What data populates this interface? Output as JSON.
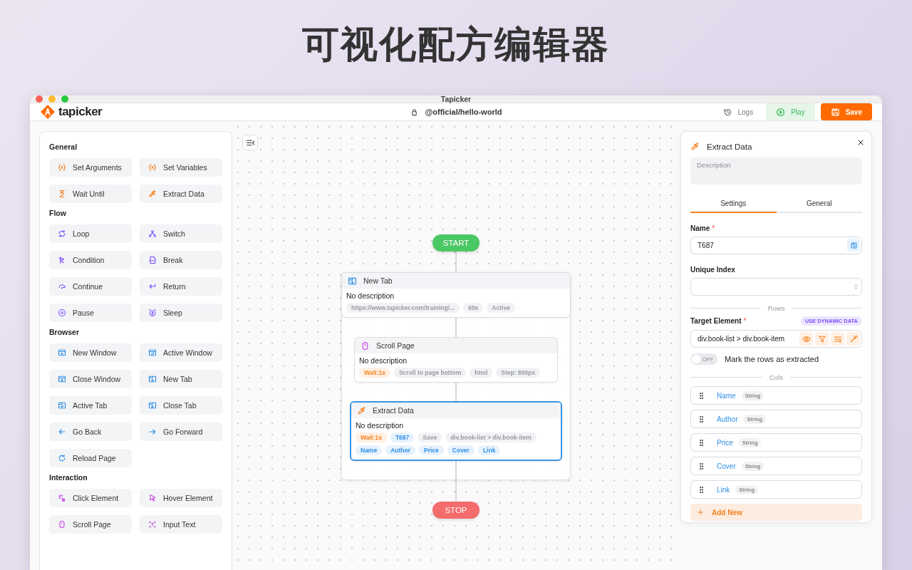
{
  "headline": "可视化配方编辑器",
  "window": {
    "title": "Tapicker"
  },
  "toolbar": {
    "logo": "tapicker",
    "project": "@official/hello-world",
    "logs": "Logs",
    "play": "Play",
    "save": "Save"
  },
  "palette": [
    {
      "title": "General",
      "kind": "general",
      "items": [
        {
          "label": "Set Arguments",
          "kind": "args"
        },
        {
          "label": "Set Variables",
          "kind": "vars"
        },
        {
          "label": "Wait Until",
          "kind": "hourglass"
        },
        {
          "label": "Extract Data",
          "kind": "dropper"
        }
      ]
    },
    {
      "title": "Flow",
      "kind": "flow",
      "items": [
        {
          "label": "Loop",
          "kind": "loop"
        },
        {
          "label": "Switch",
          "kind": "switch"
        },
        {
          "label": "Condition",
          "kind": "condition"
        },
        {
          "label": "Break",
          "kind": "break"
        },
        {
          "label": "Continue",
          "kind": "continue"
        },
        {
          "label": "Return",
          "kind": "return"
        },
        {
          "label": "Pause",
          "kind": "pause"
        },
        {
          "label": "Sleep",
          "kind": "sleep"
        }
      ]
    },
    {
      "title": "Browser",
      "kind": "browser",
      "items": [
        {
          "label": "New Window",
          "kind": "win-plus"
        },
        {
          "label": "Active Window",
          "kind": "win-check"
        },
        {
          "label": "Close Window",
          "kind": "win-x"
        },
        {
          "label": "New Tab",
          "kind": "tab-plus"
        },
        {
          "label": "Active Tab",
          "kind": "tab-check"
        },
        {
          "label": "Close Tab",
          "kind": "tab-x"
        },
        {
          "label": "Go Back",
          "kind": "back"
        },
        {
          "label": "Go Forward",
          "kind": "forward"
        },
        {
          "label": "Reload Page",
          "kind": "reload"
        }
      ]
    },
    {
      "title": "Interaction",
      "kind": "interaction",
      "items": [
        {
          "label": "Click Element",
          "kind": "click"
        },
        {
          "label": "Hover Element",
          "kind": "pointer"
        },
        {
          "label": "Scroll Page",
          "kind": "mouse"
        },
        {
          "label": "Input Text",
          "kind": "text"
        }
      ]
    }
  ],
  "flow": {
    "start": "START",
    "stop": "STOP",
    "nodes": [
      {
        "title": "New Tab",
        "kind": "tab-plus",
        "selected": false,
        "description": "No description",
        "tags": [
          {
            "text": "https://www.tapicker.com/training/...",
            "kind": "plain"
          },
          {
            "text": "60s",
            "kind": "plain"
          },
          {
            "text": "Active",
            "kind": "plain"
          }
        ]
      },
      {
        "title": "Scroll Page",
        "kind": "mouse",
        "selected": false,
        "description": "No description",
        "tags": [
          {
            "text": "Wait:1s",
            "kind": "wait"
          },
          {
            "text": "Scroll to page bottom",
            "kind": "plain"
          },
          {
            "text": "html",
            "kind": "plain"
          },
          {
            "text": "Step: 800px",
            "kind": "plain"
          }
        ]
      },
      {
        "title": "Extract Data",
        "kind": "dropper",
        "selected": true,
        "description": "No description",
        "tags": [
          {
            "text": "Wait:1s",
            "kind": "wait"
          },
          {
            "text": "T687",
            "kind": "field"
          },
          {
            "text": "Save",
            "kind": "plain"
          },
          {
            "text": "div.book-list > div.book-item",
            "kind": "plain"
          },
          {
            "text": "Name",
            "kind": "field"
          },
          {
            "text": "Author",
            "kind": "field"
          },
          {
            "text": "Price",
            "kind": "field"
          },
          {
            "text": "Cover",
            "kind": "field"
          },
          {
            "text": "Link",
            "kind": "field"
          }
        ]
      }
    ]
  },
  "props": {
    "title": "Extract Data",
    "description_placeholder": "Description",
    "tabs": [
      {
        "label": "Settings",
        "selected": true
      },
      {
        "label": "General",
        "selected": false
      }
    ],
    "name_label": "Name",
    "name_required_mark": "*",
    "name_value": "T687",
    "unique_label": "Unique Index",
    "rows_divider": "Rows",
    "target_label": "Target Element",
    "target_required_mark": "*",
    "dynamic_badge": "USE DYNAMIC DATA",
    "target_value": "div.book-list > div.book-item",
    "mark_toggle": {
      "on": false,
      "text": "OFF",
      "label": "Mark the rows as extracted"
    },
    "cols_divider": "Cols",
    "cols": [
      {
        "name": "Name",
        "type": "String"
      },
      {
        "name": "Author",
        "type": "String"
      },
      {
        "name": "Price",
        "type": "String"
      },
      {
        "name": "Cover",
        "type": "String"
      },
      {
        "name": "Link",
        "type": "String"
      }
    ],
    "add_new": "Add New"
  }
}
